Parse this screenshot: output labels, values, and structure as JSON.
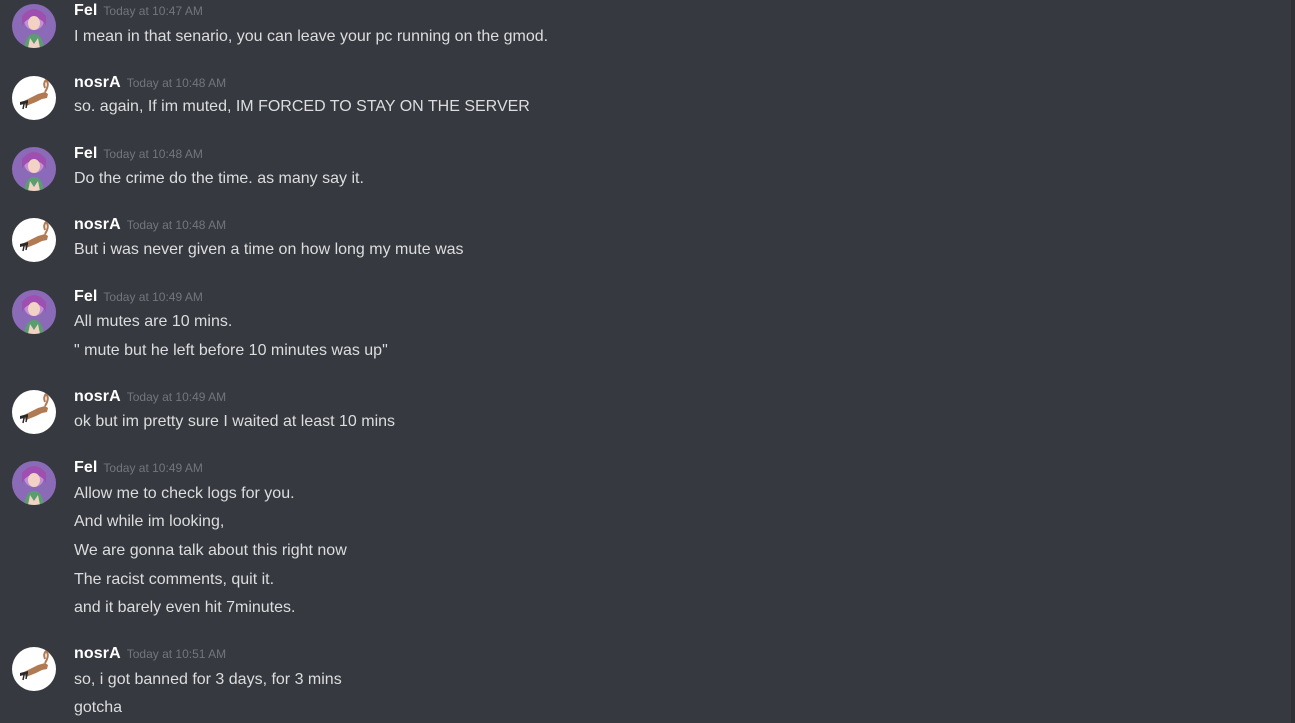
{
  "messages": [
    {
      "author": "Fel",
      "avatar": "fel-avatar",
      "timestamp": "Today at 10:47 AM",
      "lines": [
        "I mean in that senario, you can leave your pc running on the gmod."
      ]
    },
    {
      "author": "nosrA",
      "avatar": "nosra-avatar",
      "timestamp": "Today at 10:48 AM",
      "lines": [
        "so. again, If im muted, IM FORCED TO STAY ON THE SERVER"
      ]
    },
    {
      "author": "Fel",
      "avatar": "fel-avatar",
      "timestamp": "Today at 10:48 AM",
      "lines": [
        "Do the crime do the time. as many say it."
      ]
    },
    {
      "author": "nosrA",
      "avatar": "nosra-avatar",
      "timestamp": "Today at 10:48 AM",
      "lines": [
        "But i was never given a time on how long my mute was"
      ]
    },
    {
      "author": "Fel",
      "avatar": "fel-avatar",
      "timestamp": "Today at 10:49 AM",
      "lines": [
        "All mutes are 10 mins.",
        "\" mute but he left before 10 minutes was up\""
      ]
    },
    {
      "author": "nosrA",
      "avatar": "nosra-avatar",
      "timestamp": "Today at 10:49 AM",
      "lines": [
        "ok but im pretty sure I waited at least 10 mins"
      ]
    },
    {
      "author": "Fel",
      "avatar": "fel-avatar",
      "timestamp": "Today at 10:49 AM",
      "lines": [
        "Allow me to check logs for you.",
        "And while im looking,",
        "We are gonna talk about this right now",
        "The racist comments, quit it.",
        "and it barely even hit 7minutes."
      ]
    },
    {
      "author": "nosrA",
      "avatar": "nosra-avatar",
      "timestamp": "Today at 10:51 AM",
      "lines": [
        "so, i got banned for 3 days, for 3 mins",
        "gotcha"
      ]
    }
  ],
  "colors": {
    "background": "#36393f",
    "username": "#ffffff",
    "timestamp": "#72767d",
    "message_text": "#dcddde"
  }
}
